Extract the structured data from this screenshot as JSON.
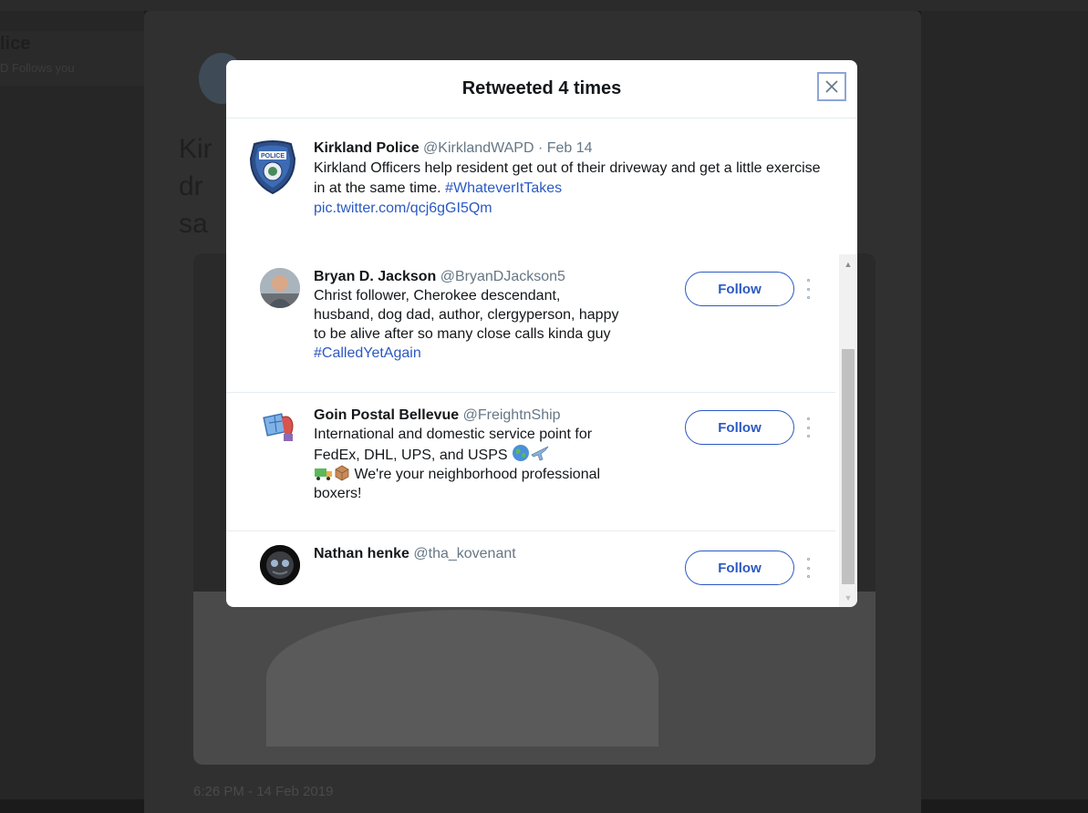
{
  "background": {
    "left_title": "lice",
    "left_sub": "D  Follows you",
    "tweet_text": "Kir                                                         r\ndr\nsa",
    "timestamp": "6:26 PM - 14 Feb 2019"
  },
  "modal": {
    "title": "Retweeted 4 times",
    "close_symbol": "×",
    "quoted_tweet": {
      "name": "Kirkland Police",
      "handle": "@KirklandWAPD",
      "separator": " · ",
      "date": "Feb 14",
      "text": "Kirkland Officers help resident get out of their driveway and get a little exercise in at the same time. ",
      "hashtag": "#WhateverItTakes",
      "link": "pic.twitter.com/qcj6gGI5Qm"
    },
    "users": [
      {
        "name": "Bryan D. Jackson",
        "handle": "@BryanDJackson5",
        "bio": "Christ follower, Cherokee descendant, husband, dog dad, author, clergyperson, happy to be alive after so many close calls kinda guy ",
        "hashtag": "#CalledYetAgain",
        "button": "Follow",
        "avatar_icon": "person-photo-icon"
      },
      {
        "name": "Goin Postal Bellevue",
        "handle": "@FreightnShip",
        "bio_start": "International and domestic service point for FedEx, DHL, UPS, and USPS",
        "bio_end": "We're your neighborhood professional boxers!",
        "button": "Follow",
        "avatar_icon": "shipping-logo-icon"
      },
      {
        "name": "Nathan henke",
        "handle": "@tha_kovenant",
        "button": "Follow",
        "avatar_icon": "robot-photo-icon"
      }
    ]
  },
  "colors": {
    "link": "#2b59c3",
    "muted": "#657786",
    "overlay": "#1b1b1b"
  }
}
